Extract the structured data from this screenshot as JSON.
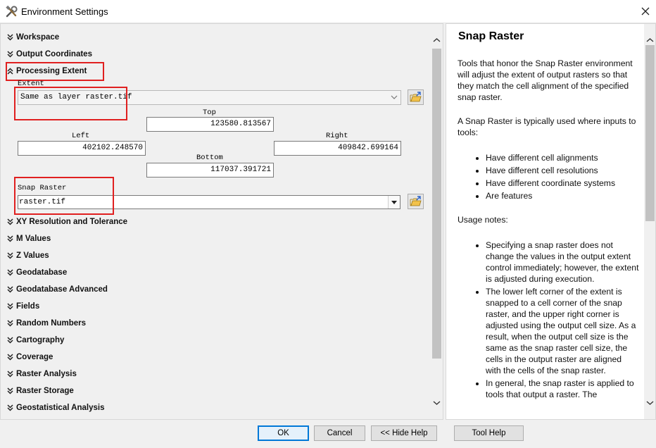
{
  "window": {
    "title": "Environment Settings"
  },
  "sections_top": [
    {
      "label": "Workspace",
      "state": "collapsed"
    },
    {
      "label": "Output Coordinates",
      "state": "collapsed"
    },
    {
      "label": "Processing Extent",
      "state": "expanded"
    }
  ],
  "extent": {
    "label": "Extent",
    "value": "Same as layer raster.tif",
    "top_label": "Top",
    "top": "123580.813567",
    "left_label": "Left",
    "left": "402102.248570",
    "right_label": "Right",
    "right": "409842.699164",
    "bottom_label": "Bottom",
    "bottom": "117037.391721"
  },
  "snap": {
    "label": "Snap Raster",
    "value": "raster.tif"
  },
  "sections_bottom": [
    "XY Resolution and Tolerance",
    "M Values",
    "Z Values",
    "Geodatabase",
    "Geodatabase Advanced",
    "Fields",
    "Random Numbers",
    "Cartography",
    "Coverage",
    "Raster Analysis",
    "Raster Storage",
    "Geostatistical Analysis"
  ],
  "help": {
    "title": "Snap Raster",
    "p1": "Tools that honor the Snap Raster environment will adjust the extent of output rasters so that they match the cell alignment of the specified snap raster.",
    "p2": "A Snap Raster is typically used where inputs to tools:",
    "bullets": [
      "Have different cell alignments",
      "Have different cell resolutions",
      "Have different coordinate systems",
      "Are features"
    ],
    "usage_heading": "Usage notes:",
    "usage": [
      "Specifying a snap raster does not change the values in the output extent control immediately; however, the extent is adjusted during execution.",
      "The lower left corner of the extent is snapped to a cell corner of the snap raster, and the upper right corner is adjusted using the output cell size. As a result, when the output cell size is the same as the snap raster cell size, the cells in the output raster are aligned with the cells of the snap raster.",
      "In general, the snap raster is applied to tools that output a raster. The"
    ]
  },
  "buttons": {
    "ok": "OK",
    "cancel": "Cancel",
    "hide_help": "<< Hide Help",
    "tool_help": "Tool Help"
  },
  "colors": {
    "highlight_box": "#e02020",
    "ok_border": "#0078d7"
  }
}
